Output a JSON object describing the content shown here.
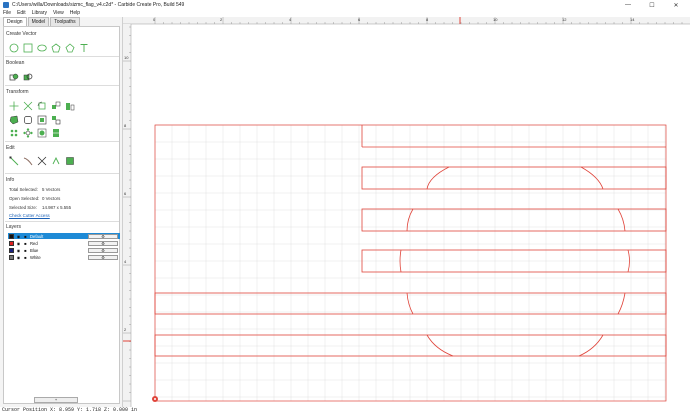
{
  "window": {
    "title": "C:/Users/willa/Downloads/sizmc_flag_v4.c2d* - Carbide Create Pro, Build 549",
    "minimize": "—",
    "maximize": "☐",
    "close": "✕"
  },
  "menu": [
    "File",
    "Edit",
    "Library",
    "View",
    "Help"
  ],
  "tabs": [
    "Design",
    "Model",
    "Toolpaths"
  ],
  "sections": {
    "create_vector": "Create Vector",
    "boolean": "Boolean",
    "transform": "Transform",
    "edit": "Edit",
    "info": "Info",
    "layers": "Layers"
  },
  "info": {
    "total_selected_label": "Total Selected:",
    "total_selected_value": "5 Vectors",
    "open_selected_label": "Open Selected:",
    "open_selected_value": "0 Vectors",
    "selected_size_label": "Selected Size:",
    "selected_size_value": "14.987 x 5.555",
    "cutter_link": "Check Cutter Access"
  },
  "layers": [
    {
      "name": "Default",
      "color": "#111111",
      "selected": true
    },
    {
      "name": "Red",
      "color": "#e02020",
      "selected": false
    },
    {
      "name": "Blue",
      "color": "#1a237e",
      "selected": false
    },
    {
      "name": "White",
      "color": "#777777",
      "selected": false
    }
  ],
  "add_layer_label": "+",
  "ruler": {
    "top_labels": [
      "0",
      "2",
      "4",
      "6",
      "8",
      "10",
      "12",
      "14"
    ],
    "left_labels": [
      "10",
      "8",
      "6",
      "4",
      "2"
    ]
  },
  "status": {
    "cursor_text": "Cursor Position X: 8.959 Y: 1.718 Z: 0.000 in"
  },
  "colors": {
    "vector": "#e0443a",
    "selection_accent": "#1e8ad6",
    "grid": "#dcdcdc"
  }
}
